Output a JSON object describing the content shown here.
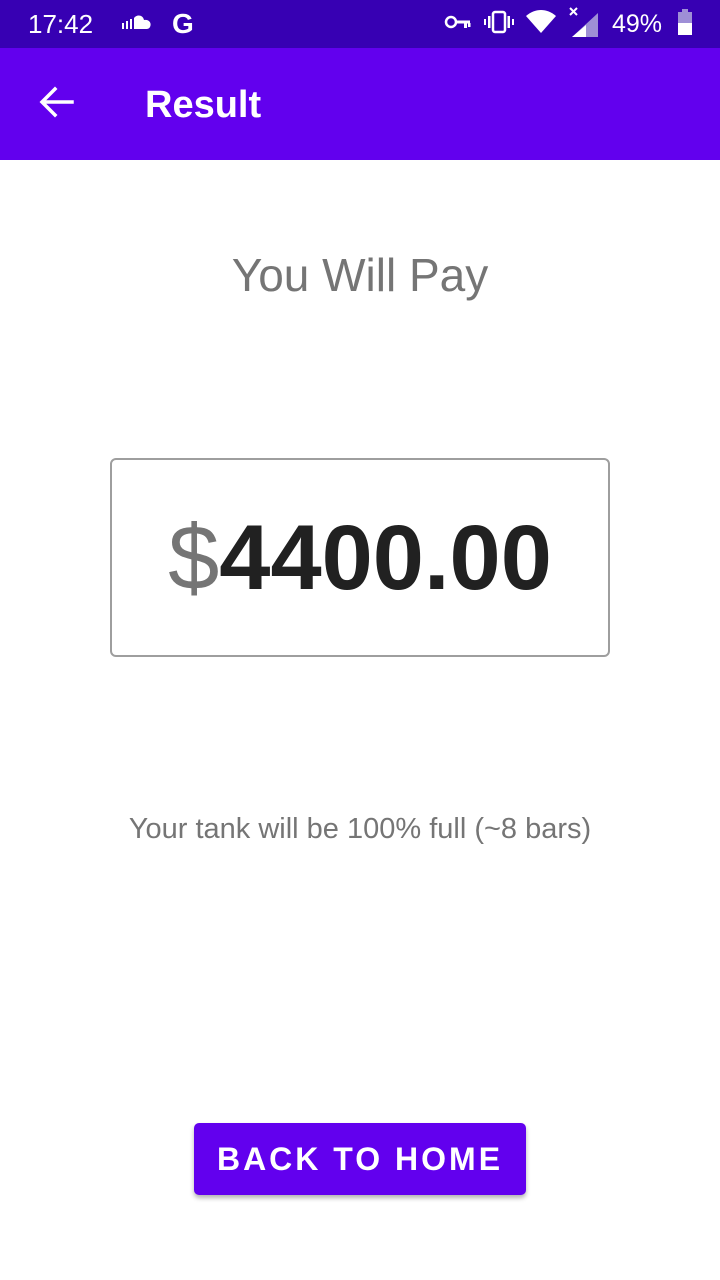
{
  "status_bar": {
    "time": "17:42",
    "battery": "49%",
    "icons": [
      "soundcloud-icon",
      "google-icon",
      "vpn-key-icon",
      "vibrate-icon",
      "wifi-icon",
      "signal-icon",
      "battery-icon"
    ],
    "google_letter": "G"
  },
  "app_bar": {
    "title": "Result",
    "back_icon": "arrow-back-icon"
  },
  "content": {
    "heading": "You Will Pay",
    "currency": "$",
    "amount": "4400.00",
    "tank_message": "Your tank will be 100% full (~8 bars)"
  },
  "actions": {
    "home_label": "BACK TO HOME"
  },
  "colors": {
    "status_bar": "#3700b3",
    "primary": "#6200ee",
    "text_secondary": "#757575",
    "text_primary": "#212121"
  }
}
